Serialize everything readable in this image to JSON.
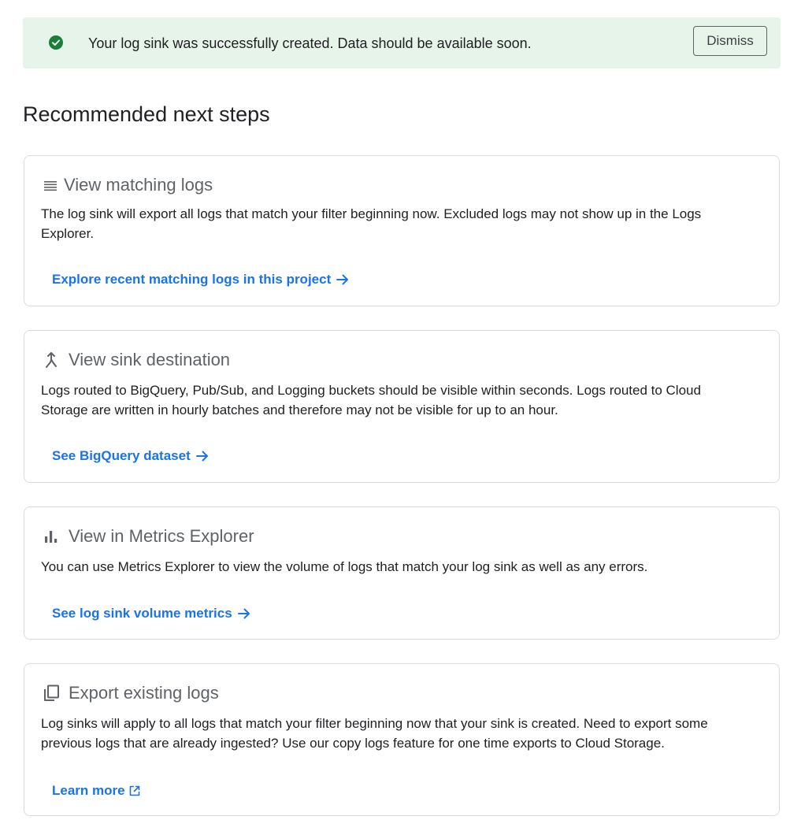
{
  "banner": {
    "message": "Your log sink was successfully created. Data should be available soon.",
    "dismiss_label": "Dismiss",
    "icon": "check-circle-icon",
    "bg_color": "#e6f4ea",
    "icon_color": "#188038"
  },
  "heading": "Recommended next steps",
  "cards": [
    {
      "icon": "list-icon",
      "title": "View matching logs",
      "description": "The log sink will export all logs that match your filter beginning now. Excluded logs may not show up in the Logs Explorer.",
      "link": "Explore recent matching logs in this project",
      "link_icon": "arrow-right-icon"
    },
    {
      "icon": "merge-icon",
      "title": "View sink destination",
      "description": "Logs routed to BigQuery, Pub/Sub, and Logging buckets should be visible within seconds. Logs routed to Cloud Storage are written in hourly batches and therefore may not be visible for up to an hour.",
      "link": "See BigQuery dataset",
      "link_icon": "arrow-right-icon"
    },
    {
      "icon": "bar-chart-icon",
      "title": "View in Metrics Explorer",
      "description": "You can use Metrics Explorer to view the volume of logs that match your log sink as well as any errors.",
      "link": "See log sink volume metrics",
      "link_icon": "arrow-right-icon"
    },
    {
      "icon": "copy-icon",
      "title": "Export existing logs",
      "description": "Log sinks will apply to all logs that match your filter beginning now that your sink is created. Need to export some previous logs that are already ingested? Use our copy logs feature for one time exports to Cloud Storage.",
      "link": "Learn more",
      "link_icon": "open-in-new-icon"
    }
  ],
  "colors": {
    "link": "#1a73e8",
    "border": "#dadce0",
    "title_gray": "#5f6368"
  }
}
